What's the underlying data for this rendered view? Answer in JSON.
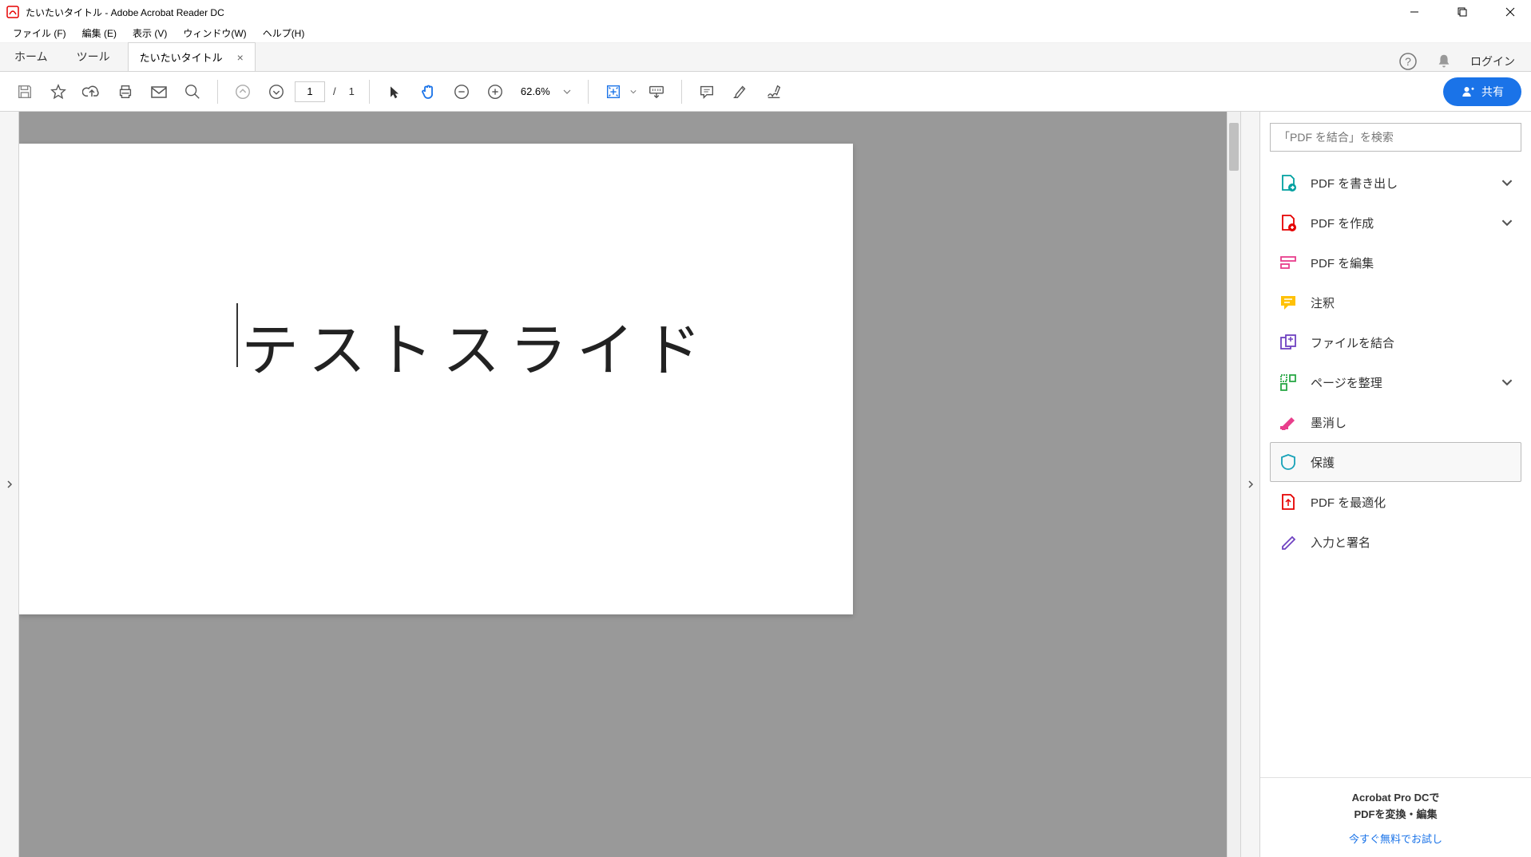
{
  "window": {
    "title": "たいたいタイトル - Adobe Acrobat Reader DC"
  },
  "menu": {
    "file": "ファイル (F)",
    "edit": "編集 (E)",
    "view": "表示 (V)",
    "window": "ウィンドウ(W)",
    "help": "ヘルプ(H)"
  },
  "tabs": {
    "home": "ホーム",
    "tools": "ツール",
    "doc_name": "たいたいタイトル",
    "login": "ログイン"
  },
  "toolbar": {
    "page_current": "1",
    "page_sep": "/",
    "page_total": "1",
    "zoom": "62.6%",
    "share": "共有"
  },
  "document": {
    "slide_text": "テストスライド"
  },
  "panel": {
    "search_placeholder": "「PDF を結合」を検索",
    "items": [
      {
        "label": "PDF を書き出し",
        "expandable": true
      },
      {
        "label": "PDF を作成",
        "expandable": true
      },
      {
        "label": "PDF を編集",
        "expandable": false
      },
      {
        "label": "注釈",
        "expandable": false
      },
      {
        "label": "ファイルを結合",
        "expandable": false
      },
      {
        "label": "ページを整理",
        "expandable": true
      },
      {
        "label": "墨消し",
        "expandable": false
      },
      {
        "label": "保護",
        "expandable": false,
        "selected": true
      },
      {
        "label": "PDF を最適化",
        "expandable": false
      },
      {
        "label": "入力と署名",
        "expandable": false
      }
    ]
  },
  "promo": {
    "line1": "Acrobat Pro DCで",
    "line2": "PDFを変換・編集",
    "cta": "今すぐ無料でお試し"
  }
}
